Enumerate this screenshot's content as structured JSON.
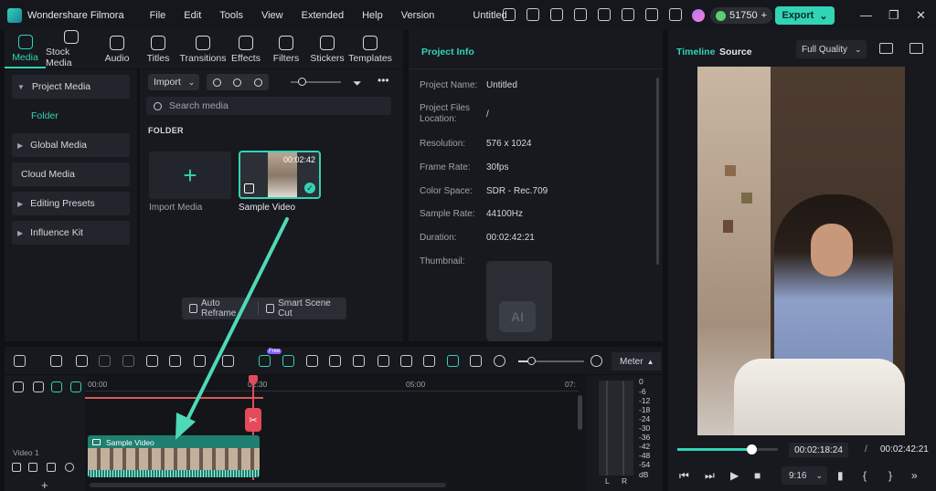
{
  "app": {
    "name": "Wondershare Filmora",
    "menu": [
      "File",
      "Edit",
      "Tools",
      "View",
      "Extended",
      "Help",
      "Version"
    ],
    "doc_title": "Untitled",
    "credits": "51750",
    "export_label": "Export"
  },
  "media_tabs": [
    "Media",
    "Stock Media",
    "Audio",
    "Titles",
    "Transitions",
    "Effects",
    "Filters",
    "Stickers",
    "Templates"
  ],
  "left_nav": {
    "project_media": "Project Media",
    "folder": "Folder",
    "global_media": "Global Media",
    "cloud_media": "Cloud Media",
    "editing_presets": "Editing Presets",
    "influence_kit": "Influence Kit"
  },
  "media": {
    "import_label": "Import",
    "search_placeholder": "Search media",
    "folder_heading": "FOLDER",
    "import_tile_label": "Import Media",
    "video_label": "Sample Video",
    "video_duration": "00:02:42",
    "auto_reframe": "Auto Reframe",
    "smart_scene_cut": "Smart Scene Cut"
  },
  "project_info": {
    "title": "Project Info",
    "rows": [
      {
        "label": "Project Name:",
        "value": "Untitled"
      },
      {
        "label": "Project Files Location:",
        "value": "/"
      },
      {
        "label": "Resolution:",
        "value": "576 x 1024"
      },
      {
        "label": "Frame Rate:",
        "value": "30fps"
      },
      {
        "label": "Color Space:",
        "value": "SDR - Rec.709"
      },
      {
        "label": "Sample Rate:",
        "value": "44100Hz"
      },
      {
        "label": "Duration:",
        "value": "00:02:42:21"
      },
      {
        "label": "Thumbnail:",
        "value": ""
      }
    ]
  },
  "preview": {
    "tab_timeline": "Timeline",
    "tab_source": "Source",
    "quality": "Full Quality",
    "current_time": "00:02:18:24",
    "separator": "/",
    "total_time": "00:02:42:21",
    "ratio": "9:16",
    "progress_fraction": 0.85
  },
  "timeline": {
    "meter_label": "Meter",
    "ruler": [
      "00:00",
      "02:30",
      "05:00",
      "07:"
    ],
    "track_name": "Video 1",
    "clip_name": "Sample Video",
    "free_badge": "Free",
    "db_scale": [
      "0",
      "-6",
      "-12",
      "-18",
      "-24",
      "-30",
      "-36",
      "-42",
      "-48",
      "-54",
      "dB"
    ],
    "left_channel": "L",
    "right_channel": "R"
  }
}
